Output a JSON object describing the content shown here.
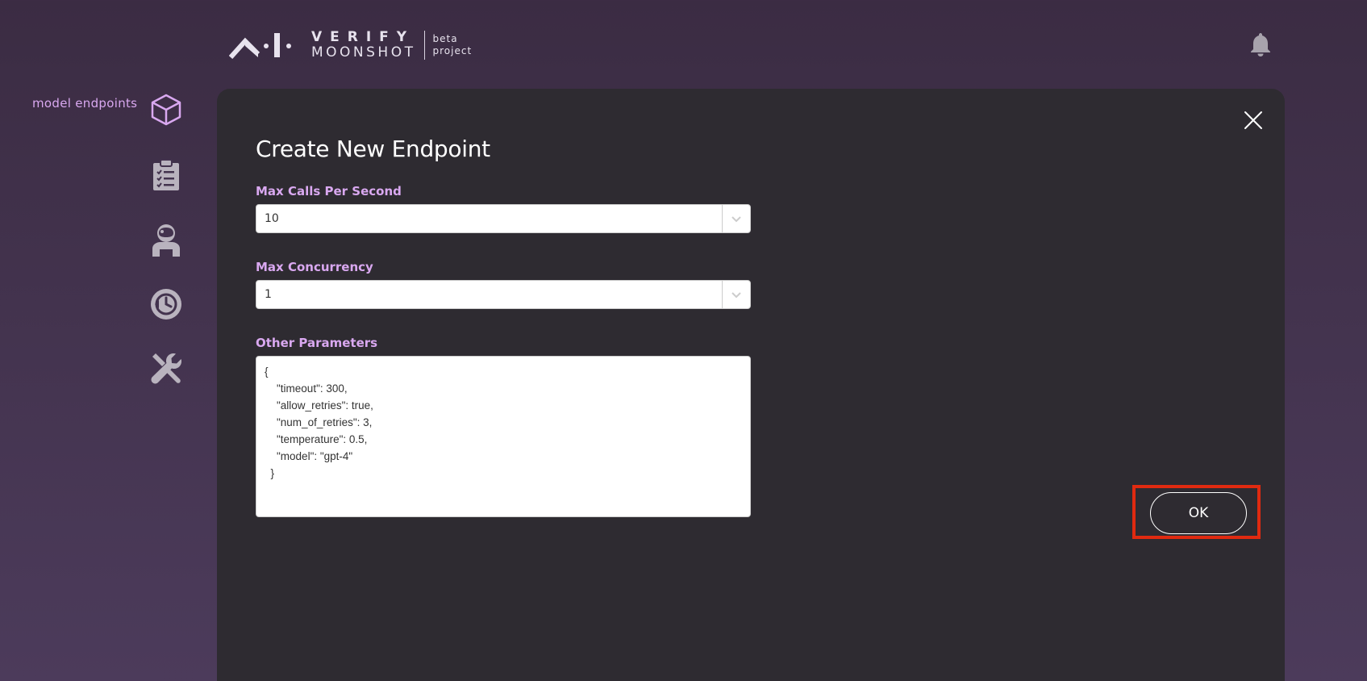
{
  "header": {
    "logo_line1": "VERIFY",
    "logo_line2": "MOONSHOT",
    "tag_line1": "beta",
    "tag_line2": "project"
  },
  "sidebar": {
    "active_label": "model endpoints",
    "items": [
      {
        "icon": "cube-icon"
      },
      {
        "icon": "clipboard-checklist-icon"
      },
      {
        "icon": "astronaut-icon"
      },
      {
        "icon": "history-icon"
      },
      {
        "icon": "tools-icon"
      }
    ]
  },
  "dialog": {
    "title": "Create New Endpoint",
    "fields": {
      "max_calls_label": "Max Calls Per Second",
      "max_calls_value": "10",
      "max_concurrency_label": "Max Concurrency",
      "max_concurrency_value": "1",
      "other_params_label": "Other Parameters",
      "other_params_value": "{\n    \"timeout\": 300,\n    \"allow_retries\": true,\n    \"num_of_retries\": 3,\n    \"temperature\": 0.5,\n    \"model\": \"gpt-4\"\n  }"
    },
    "ok_label": "OK"
  },
  "colors": {
    "accent": "#d9a8f0",
    "panel": "#2e2b31",
    "highlight": "#e02a10"
  }
}
